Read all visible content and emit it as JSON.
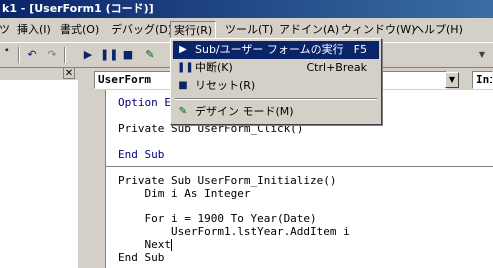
{
  "title": "k1 - [UserForm1 (コード)]",
  "menu": [
    {
      "label": "ツ",
      "active": false
    },
    {
      "label": "挿入(I)",
      "active": false
    },
    {
      "label": "書式(O)",
      "active": false
    },
    {
      "label": "デバッグ(D)",
      "active": false
    },
    {
      "label": "実行(R)",
      "active": true
    },
    {
      "label": "ツール(T)",
      "active": false
    },
    {
      "label": "アドイン(A)",
      "active": false
    },
    {
      "label": "ウィンドウ(W)",
      "active": false
    },
    {
      "label": "ヘルプ(H)",
      "active": false
    }
  ],
  "toolbar": {
    "icons": [
      "find-icon",
      "undo-icon",
      "redo-icon",
      "run-icon",
      "break-icon",
      "reset-icon",
      "design-mode-icon"
    ]
  },
  "object_combo": "UserForm",
  "proc_combo": "Init",
  "run_menu": {
    "items": [
      {
        "label": "Sub/ユーザー フォームの実行",
        "shortcut": "F5",
        "icon": "run-icon"
      },
      {
        "label": "中断(K)",
        "shortcut": "Ctrl+Break",
        "icon": "break-icon"
      },
      {
        "label": "リセット(R)",
        "shortcut": "",
        "icon": "reset-icon"
      },
      {
        "label": "デザイン モード(M)",
        "shortcut": "",
        "icon": "design-mode-icon"
      }
    ]
  },
  "code": {
    "lines": [
      "Option E",
      "",
      "Private Sub UserForm_Click()",
      "",
      "End Sub",
      "",
      "Private Sub UserForm_Initialize()",
      "    Dim i As Integer",
      "",
      "    For i = 1900 To Year(Date)",
      "        UserForm1.lstYear.AddItem i",
      "    Next",
      "End Sub"
    ]
  }
}
